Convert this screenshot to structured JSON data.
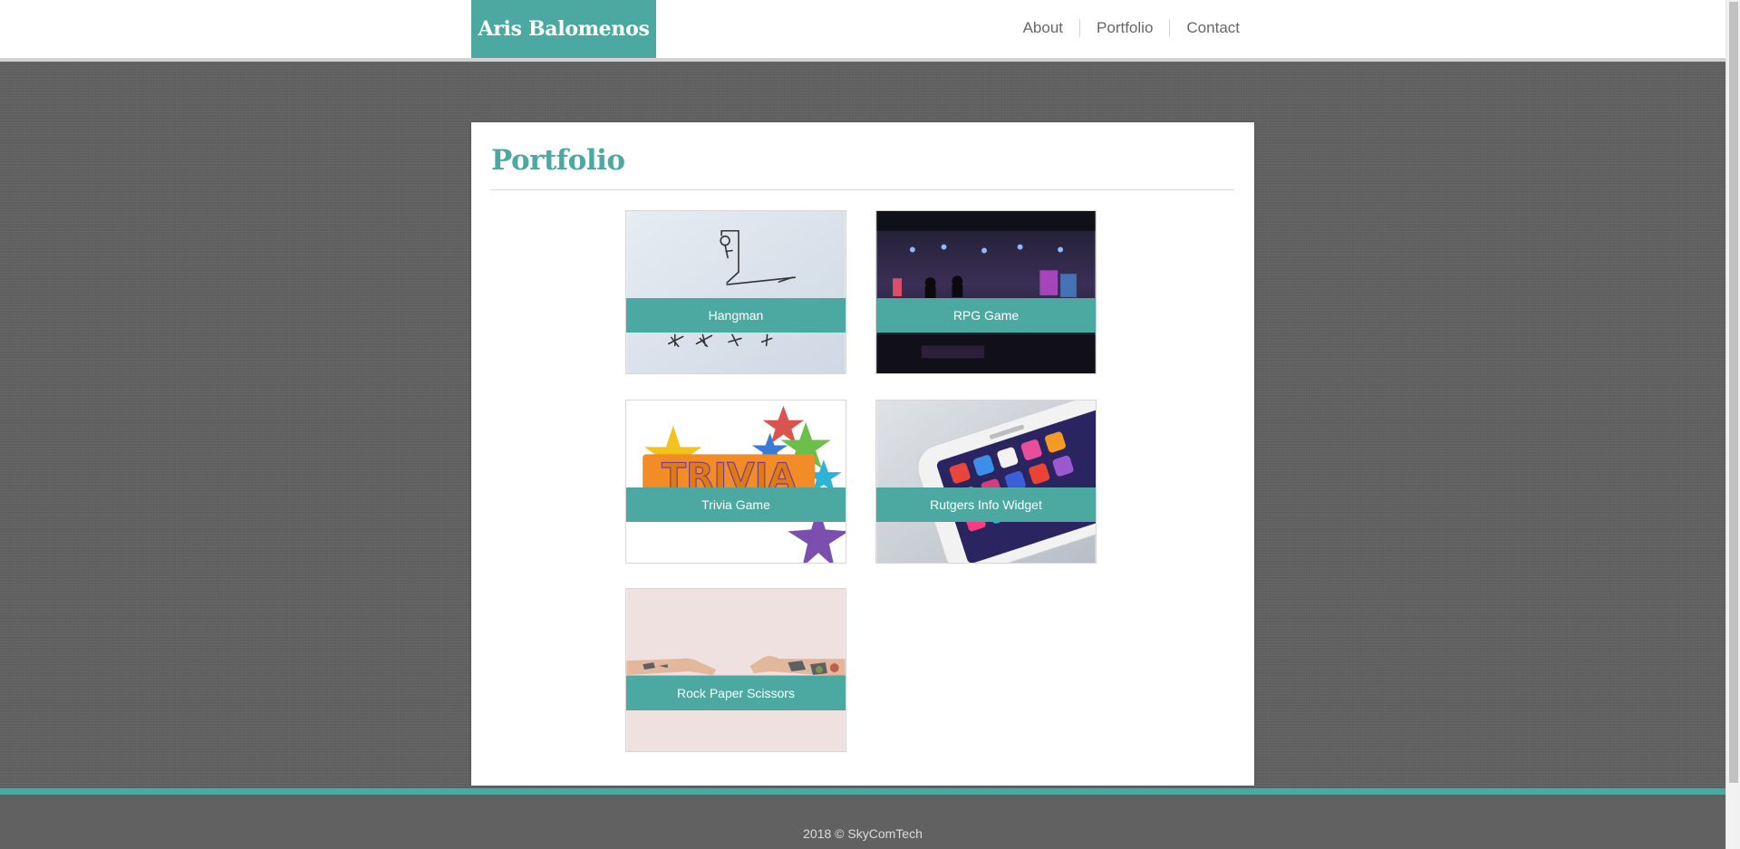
{
  "header": {
    "brand": "Aris Balomenos",
    "nav": [
      {
        "label": "About"
      },
      {
        "label": "Portfolio"
      },
      {
        "label": "Contact"
      }
    ]
  },
  "main": {
    "title": "Portfolio",
    "projects": [
      {
        "label": "Hangman"
      },
      {
        "label": "RPG Game"
      },
      {
        "label": "Trivia Game"
      },
      {
        "label": "Rutgers Info Widget"
      },
      {
        "label": "Rock Paper Scissors"
      }
    ]
  },
  "footer": {
    "text": "2018 © SkyComTech"
  },
  "colors": {
    "accent": "#4ba9a2",
    "background": "#616161",
    "nav_text": "#666666"
  }
}
